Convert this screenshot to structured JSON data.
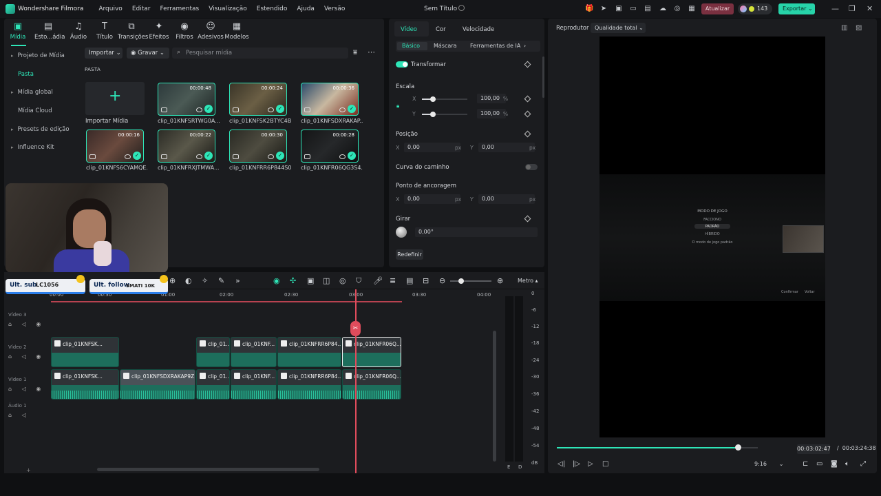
{
  "titlebar": {
    "app_name": "Wondershare Filmora",
    "menus": [
      "Arquivo",
      "Editar",
      "Ferramentas",
      "Visualização",
      "Estendido",
      "Ajuda",
      "Versão"
    ],
    "document_title": "Sem Título",
    "update_label": "Atualizar",
    "credits": "143",
    "export_label": "Exportar"
  },
  "media_tabs": [
    {
      "label": "Mídia",
      "icon": "media-icon"
    },
    {
      "label": "Esto...ádia",
      "icon": "stock-icon"
    },
    {
      "label": "Áudio",
      "icon": "music-icon"
    },
    {
      "label": "Título",
      "icon": "text-icon"
    },
    {
      "label": "Transições",
      "icon": "transition-icon"
    },
    {
      "label": "Efeitos",
      "icon": "effects-icon"
    },
    {
      "label": "Filtros",
      "icon": "filter-icon"
    },
    {
      "label": "Adesivos",
      "icon": "sticker-icon"
    },
    {
      "label": "Modelos",
      "icon": "template-icon"
    }
  ],
  "sidebar": {
    "items": [
      "Projeto de Mídia",
      "Pasta",
      "Mídia global",
      "Mídia Cloud",
      "Presets de edição",
      "Influence Kit"
    ]
  },
  "media_toolbar": {
    "import_label": "Importar",
    "record_label": "Gravar",
    "search_placeholder": "Pesquisar mídia"
  },
  "media": {
    "folder_label": "PASTA",
    "import_tile_label": "Importar Mídia",
    "clips": [
      {
        "name": "clip_01KNFSRTWG0A...",
        "duration": "00:00:48"
      },
      {
        "name": "clip_01KNFSK2BTYC4B...",
        "duration": "00:00:24"
      },
      {
        "name": "clip_01KNFSDXRAKAP...",
        "duration": "00:00:36"
      },
      {
        "name": "clip_01KNFS6CYAMQE...",
        "duration": "00:00:16"
      },
      {
        "name": "clip_01KNFRXJTMWA...",
        "duration": "00:00:22"
      },
      {
        "name": "clip_01KNFRR6P844S0...",
        "duration": "00:00:30"
      },
      {
        "name": "clip_01KNFR06QG3S4...",
        "duration": "00:00:28"
      }
    ]
  },
  "properties": {
    "tabs": [
      "Vídeo",
      "Cor",
      "Velocidade"
    ],
    "subtabs": [
      "Básico",
      "Máscara",
      "Ferramentas de IA"
    ],
    "transform_label": "Transformar",
    "scale_label": "Escala",
    "scale_x": "100,00",
    "scale_y": "100,00",
    "percent_unit": "%",
    "position_label": "Posição",
    "position_x": "0,00",
    "position_y": "0,00",
    "px_unit": "px",
    "path_curve_label": "Curva do caminho",
    "anchor_label": "Ponto de ancoragem",
    "anchor_x": "0,00",
    "anchor_y": "0,00",
    "rotate_label": "Girar",
    "rotate_value": "0,00°",
    "reset_label": "Redefinir",
    "x_axis": "X",
    "y_axis": "Y"
  },
  "player": {
    "title": "Reprodutor",
    "quality": "Qualidade total",
    "current_time": "00:03:02:47",
    "total_time": "00:03:24:38",
    "time_separator": "/",
    "ratio": "9:16",
    "progress_fraction": 0.9,
    "preview_texts": [
      "MODO DE JOGO",
      "FACCIONO",
      "PADRÃO",
      "HÍBRIDO",
      "O modo de jogo padrão",
      "Confirmar",
      "Voltar"
    ]
  },
  "timeline": {
    "meter_label": "Metro",
    "ruler": [
      "00:00",
      "00:30",
      "01:00",
      "01:30",
      "02:00",
      "02:30",
      "03:00",
      "03:30",
      "04:00"
    ],
    "tracks": [
      {
        "name": "Vídeo 3"
      },
      {
        "name": "Vídeo 2"
      },
      {
        "name": "Vídeo 1"
      },
      {
        "name": "Áudio 1"
      }
    ],
    "video2_clips": [
      "clip_01KNFSK...",
      "clip_01...",
      "clip_01KNF...",
      "clip_01KNFRR6P84...",
      "clip_01KNFR06Q..."
    ],
    "video1_clips": [
      "clip_01KNFSK...",
      "clip_01KNFSDXRAKAP9Z...",
      "clip_01...",
      "clip_01KNF...",
      "clip_01KNFRR6P84...",
      "clip_01KNFR06Q..."
    ],
    "meter_scale": [
      "0",
      "-6",
      "-12",
      "-18",
      "-24",
      "-30",
      "-36",
      "-42",
      "-48",
      "-54",
      "dB"
    ],
    "meter_channels": [
      "E",
      "D"
    ]
  },
  "overlays": {
    "sub_label": "Ult. sub",
    "sub_value": "LC1056",
    "follow_label": "Ult. follow",
    "follow_value": "SMATI 10K"
  },
  "colors": {
    "accent": "#2ee6b8",
    "playhead": "#e04c5c",
    "update_button": "#7a3040"
  }
}
